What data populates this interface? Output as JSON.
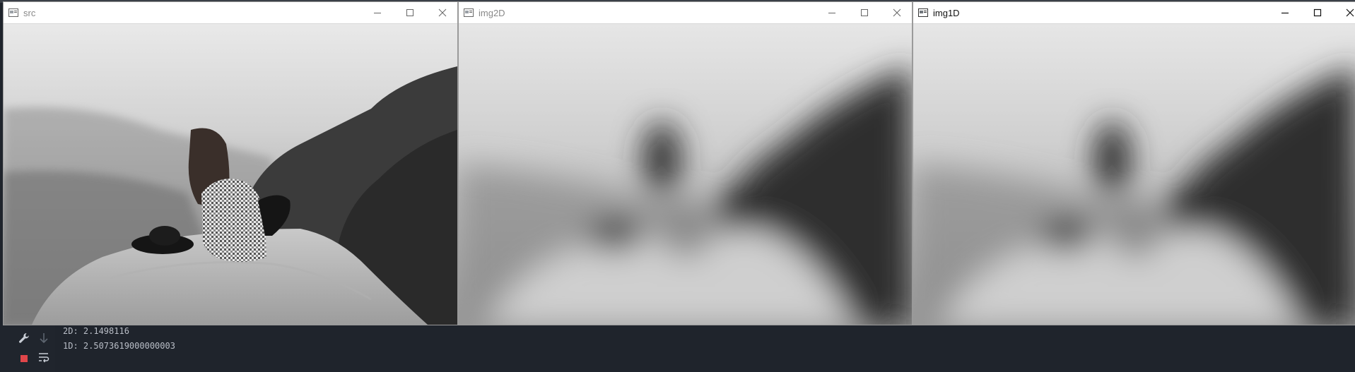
{
  "windows": [
    {
      "title": "src",
      "active": false
    },
    {
      "title": "img2D",
      "active": false
    },
    {
      "title": "img1D",
      "active": true
    }
  ],
  "window_controls": [
    "minimize-icon",
    "maximize-icon",
    "close-icon"
  ],
  "console": {
    "lines": [
      "2D: 2.1498116",
      "1D: 2.5073619000000003"
    ],
    "tools": [
      "wrench-icon",
      "scroll-down-icon",
      "stop-icon",
      "soft-wrap-icon"
    ],
    "colors": {
      "background": "#1f242c",
      "text": "#b9bec7",
      "stop": "#e0464a"
    }
  }
}
